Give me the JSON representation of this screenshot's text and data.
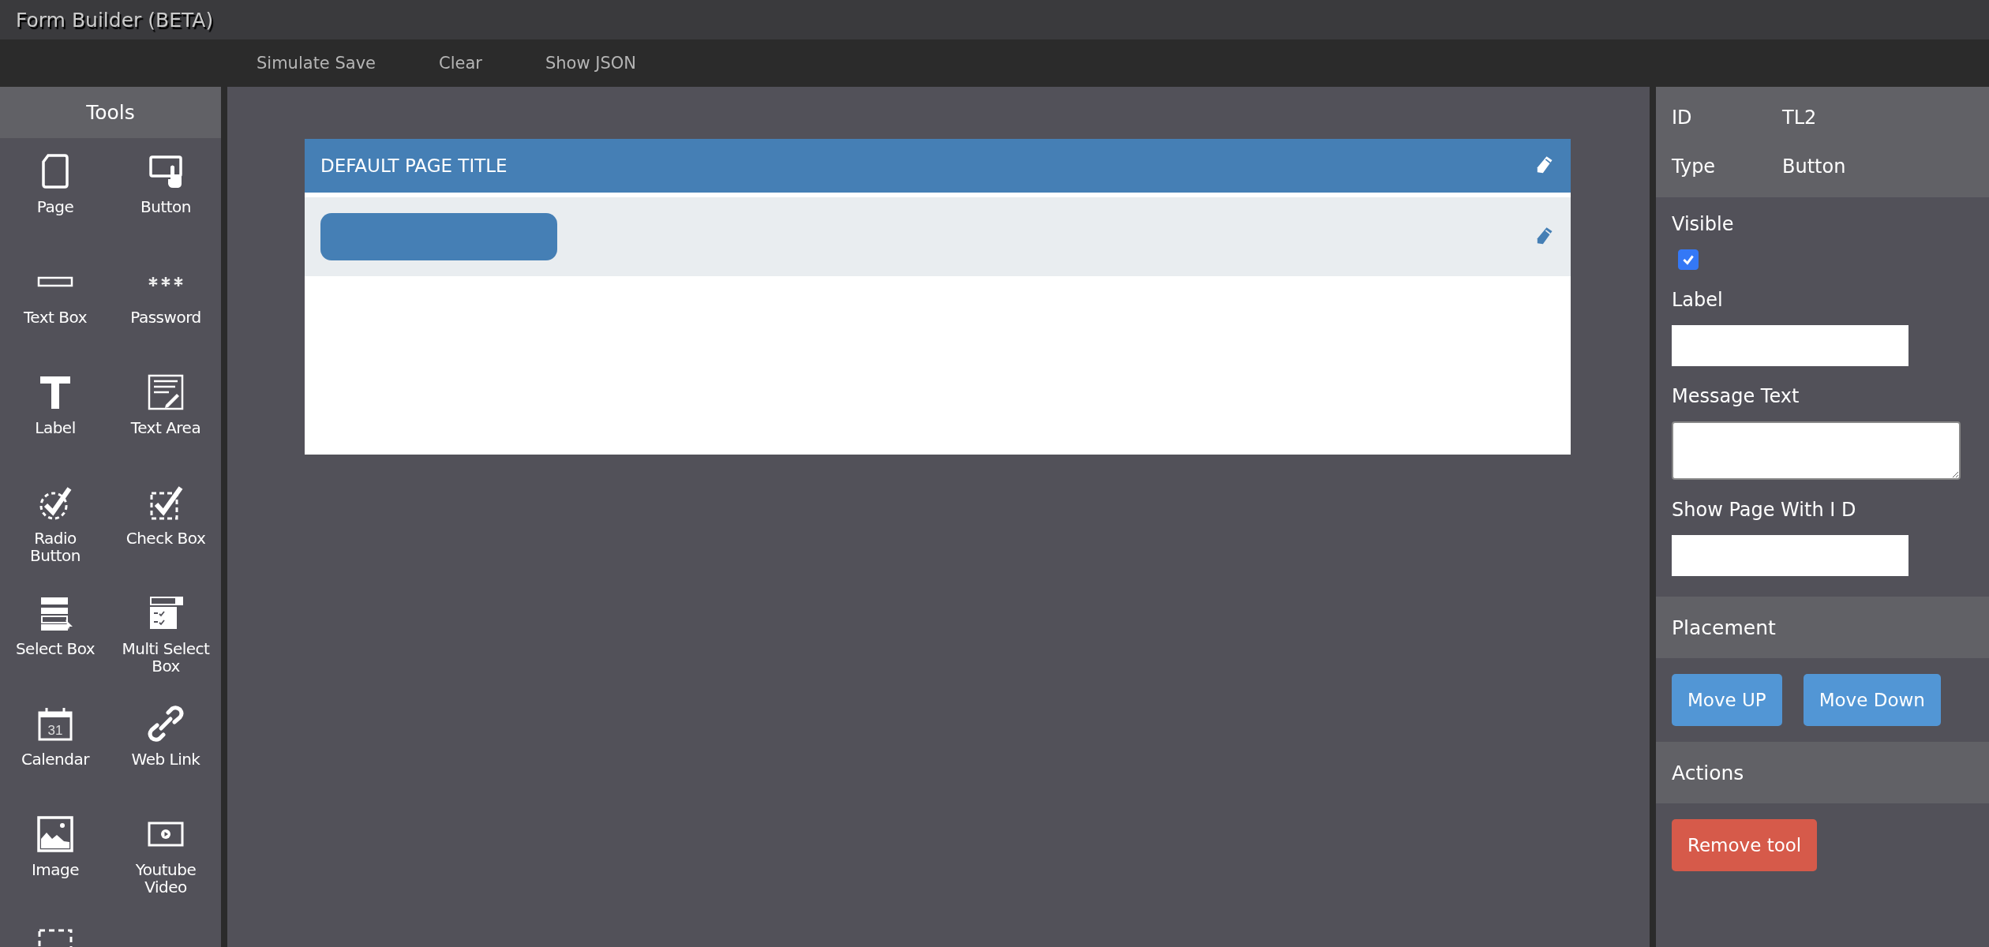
{
  "window": {
    "title": "Form Builder (BETA)"
  },
  "menu": [
    "Simulate Save",
    "Clear",
    "Show JSON"
  ],
  "tools": {
    "title": "Tools",
    "items": [
      {
        "kind": "page",
        "label": "Page"
      },
      {
        "kind": "button",
        "label": "Button"
      },
      {
        "kind": "textbox",
        "label": "Text Box"
      },
      {
        "kind": "password",
        "label": "Password"
      },
      {
        "kind": "label",
        "label": "Label"
      },
      {
        "kind": "textarea",
        "label": "Text Area"
      },
      {
        "kind": "radio",
        "label": "Radio Button"
      },
      {
        "kind": "checkbox",
        "label": "Check Box"
      },
      {
        "kind": "select",
        "label": "Select Box"
      },
      {
        "kind": "multiselect",
        "label": "Multi Select Box"
      },
      {
        "kind": "calendar",
        "label": "Calendar",
        "icon_text": "31"
      },
      {
        "kind": "weblink",
        "label": "Web Link"
      },
      {
        "kind": "image",
        "label": "Image"
      },
      {
        "kind": "video",
        "label": "Youtube Video"
      },
      {
        "kind": "dashed"
      }
    ]
  },
  "form": {
    "title": "DEFAULT PAGE TITLE",
    "elements": [
      {
        "kind": "button"
      }
    ]
  },
  "properties": {
    "id_label": "ID",
    "id_value": "TL2",
    "type_label": "Type",
    "type_value": "Button",
    "fields": [
      {
        "kind": "checkbox",
        "label": "Visible",
        "checked": true
      },
      {
        "kind": "text",
        "label": "Label"
      },
      {
        "kind": "textarea",
        "label": "Message Text"
      },
      {
        "kind": "text",
        "label": "Show Page With I D"
      }
    ]
  },
  "placement": {
    "title": "Placement",
    "buttons": [
      "Move UP",
      "Move Down"
    ]
  },
  "actions": {
    "title": "Actions",
    "buttons": [
      "Remove tool"
    ]
  }
}
